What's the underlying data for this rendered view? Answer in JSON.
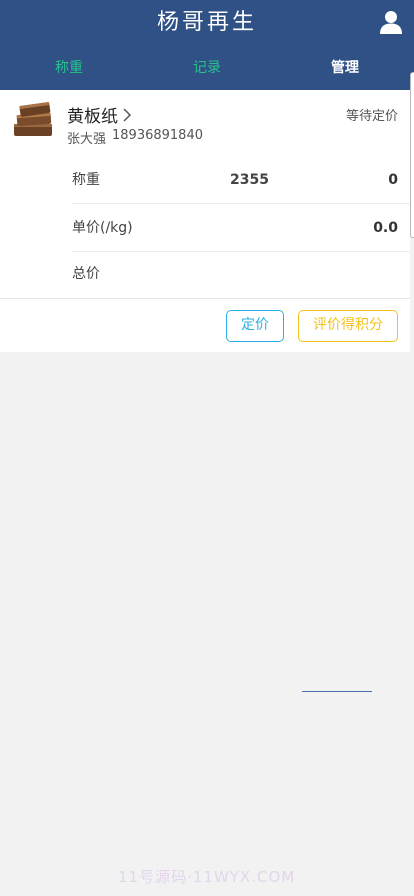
{
  "header": {
    "title": "杨哥再生",
    "user_icon": "user-icon"
  },
  "tabs": [
    {
      "label": "称重",
      "active": false
    },
    {
      "label": "记录",
      "active": false
    },
    {
      "label": "管理",
      "active": true
    }
  ],
  "colors": {
    "header_bg": "#2f5185",
    "tab_inactive": "#23c48b",
    "price_button": "#2ab0e6",
    "rate_button": "#f3c31d"
  },
  "order": {
    "item_name": "黄板纸",
    "status": "等待定价",
    "customer_name": "张大强",
    "customer_phone": "18936891840",
    "rows": [
      {
        "label": "称重",
        "middle": "2355",
        "value": "0"
      },
      {
        "label": "单价(/kg)",
        "middle": "",
        "value": "0.0"
      },
      {
        "label": "总价",
        "middle": "",
        "value": ""
      }
    ],
    "buttons": {
      "set_price": "定价",
      "rate_points": "评价得积分"
    }
  },
  "watermark": "11号源码·11WYX.COM"
}
